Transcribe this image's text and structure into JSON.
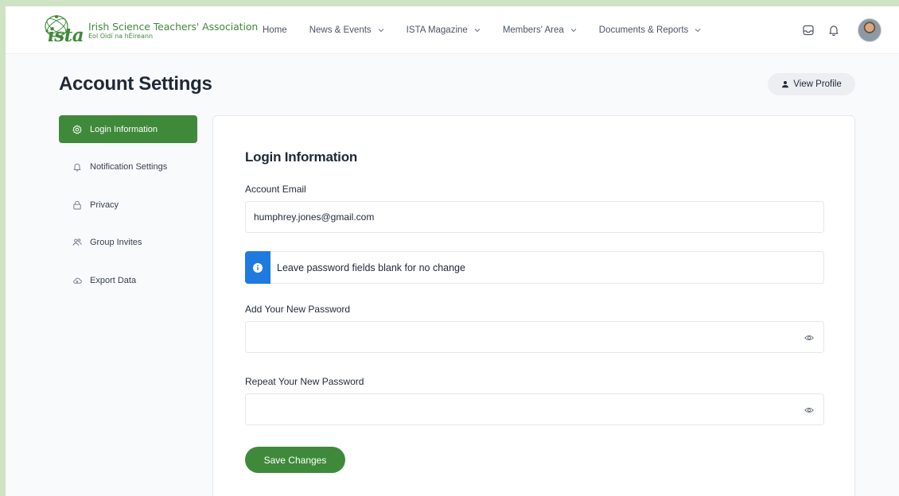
{
  "brand": {
    "mark": "ista",
    "name": "Irish Science Teachers' Association",
    "subtitle": "Eol Oidí na hÉireann",
    "color": "#3f8a3a"
  },
  "nav": {
    "items": [
      {
        "label": "Home",
        "dropdown": false
      },
      {
        "label": "News & Events",
        "dropdown": true
      },
      {
        "label": "ISTA Magazine",
        "dropdown": true
      },
      {
        "label": "Members' Area",
        "dropdown": true
      },
      {
        "label": "Documents & Reports",
        "dropdown": true
      }
    ],
    "icons": [
      "inbox-icon",
      "bell-icon"
    ]
  },
  "page": {
    "title": "Account Settings",
    "view_profile_label": "View Profile"
  },
  "sidebar": {
    "items": [
      {
        "label": "Login Information",
        "icon": "gear-icon",
        "active": true
      },
      {
        "label": "Notification Settings",
        "icon": "bell-icon",
        "active": false
      },
      {
        "label": "Privacy",
        "icon": "lock-icon",
        "active": false
      },
      {
        "label": "Group Invites",
        "icon": "users-icon",
        "active": false
      },
      {
        "label": "Export Data",
        "icon": "cloud-icon",
        "active": false
      }
    ]
  },
  "form": {
    "section_title": "Login Information",
    "email_label": "Account Email",
    "email_value": "humphrey.jones@gmail.com",
    "notice_text": "Leave password fields blank for no change",
    "new_password_label": "Add Your New Password",
    "new_password_value": "",
    "repeat_password_label": "Repeat Your New Password",
    "repeat_password_value": "",
    "save_label": "Save Changes"
  },
  "colors": {
    "accent": "#3f8a3a",
    "info": "#1f7ae0",
    "background_outer": "#cfe3c4"
  }
}
